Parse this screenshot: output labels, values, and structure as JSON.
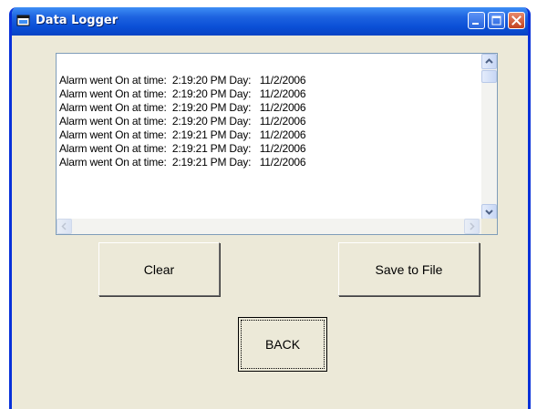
{
  "window": {
    "title": "Data Logger"
  },
  "log": {
    "items": [
      "Alarm went On at time:  2:19:20 PM Day:   11/2/2006",
      "Alarm went On at time:  2:19:20 PM Day:   11/2/2006",
      "Alarm went On at time:  2:19:20 PM Day:   11/2/2006",
      "Alarm went On at time:  2:19:20 PM Day:   11/2/2006",
      "Alarm went On at time:  2:19:21 PM Day:   11/2/2006",
      "Alarm went On at time:  2:19:21 PM Day:   11/2/2006",
      "Alarm went On at time:  2:19:21 PM Day:   11/2/2006"
    ]
  },
  "buttons": {
    "clear": "Clear",
    "save": "Save to File",
    "back": "BACK"
  },
  "icons": {
    "app": "window-icon",
    "minimize": "minimize-icon",
    "maximize": "maximize-icon",
    "close": "close-icon"
  },
  "colors": {
    "titlebar": "#0a4fd6",
    "window_bg": "#ece9d8",
    "close_button": "#c2411e"
  }
}
